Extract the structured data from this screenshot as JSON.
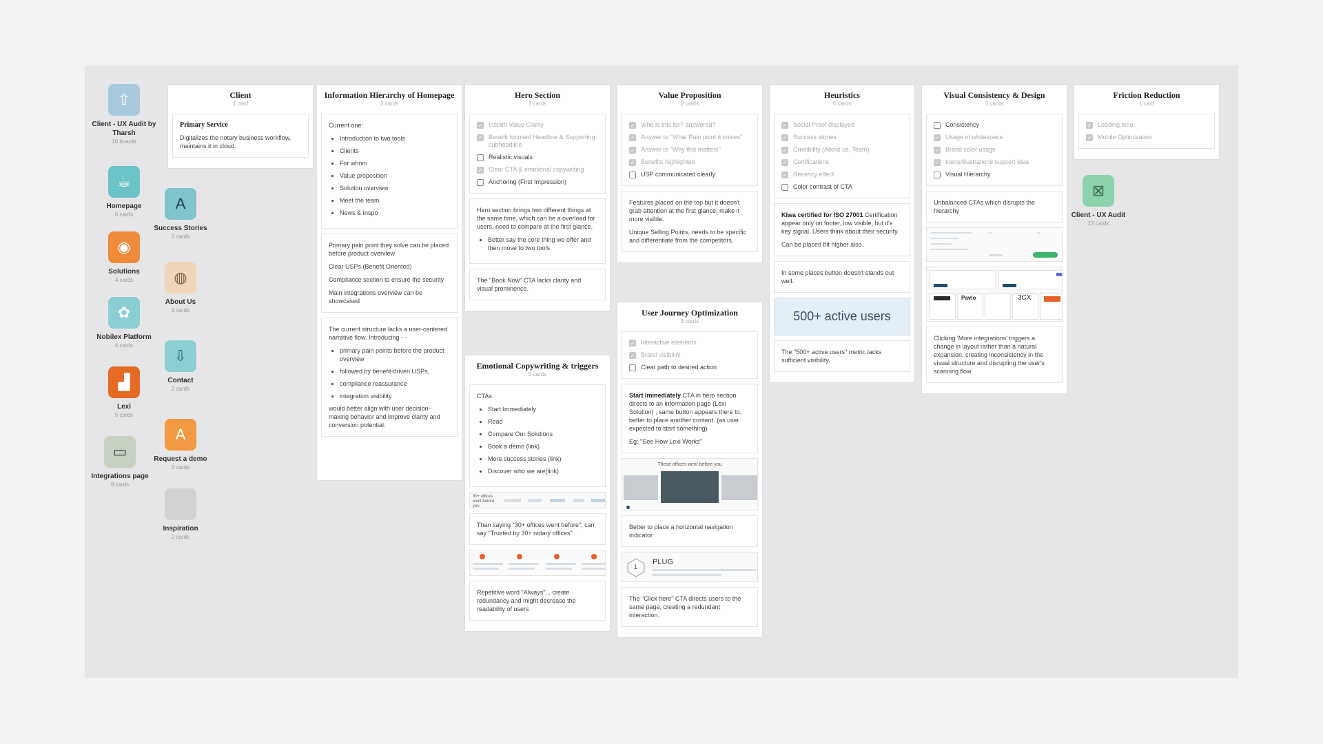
{
  "sidebar_boards": [
    {
      "name": "Client - UX Audit by Tharsh",
      "count": "10 boards",
      "icon": "upload-chart-icon",
      "color": "#a9c9dd"
    },
    {
      "name": "Homepage",
      "count": "6 cards",
      "icon": "coffee-icon",
      "color": "#6bc3c7"
    },
    {
      "name": "Solutions",
      "count": "4 cards",
      "icon": "basketball-icon",
      "color": "#ef8a3b"
    },
    {
      "name": "Nobilex Platform",
      "count": "4 cards",
      "icon": "butterfly-icon",
      "color": "#8ccfd3"
    },
    {
      "name": "Lexi",
      "count": "5 cards",
      "icon": "dog-icon",
      "color": "#e56a24"
    },
    {
      "name": "Integrations page",
      "count": "8 cards",
      "icon": "device-icon",
      "color": "#c5d2c2"
    },
    {
      "name": "Success Stories",
      "count": "3 cards",
      "icon": "book-icon",
      "color": "#7fc4cc"
    },
    {
      "name": "About Us",
      "count": "3 cards",
      "icon": "baseball-icon",
      "color": "#efd6b8"
    },
    {
      "name": "Contact",
      "count": "2 cards",
      "icon": "download-icon",
      "color": "#8ccfd3"
    },
    {
      "name": "Request a demo",
      "count": "3 cards",
      "icon": "letter-a-icon",
      "color": "#f19a43"
    },
    {
      "name": "Inspiration",
      "count": "2 cards",
      "icon": "blank-icon",
      "color": "#d2d2d4"
    },
    {
      "name": "Client - UX Audit",
      "count": "12 cards",
      "icon": "no-image-icon",
      "color": "#8cd3ad"
    }
  ],
  "tile_glyphs": {
    "upload": "⇧",
    "coffee": "☕",
    "ball": "◉",
    "butterfly": "✿",
    "dog": "▟",
    "device": "▭",
    "book": "A",
    "baseball": "◍",
    "download": "⇩",
    "letter": "A",
    "blank": "",
    "noimg": "⊠"
  },
  "columns": {
    "client": {
      "title": "Client",
      "count": "1 card",
      "card_title": "Primary Service",
      "card_text": "Digitalizes the notary business workflow, maintains it in cloud."
    },
    "info": {
      "title": "Information Hierarchy of Homepage",
      "count": "3 cards",
      "card1_intro": "Current one:",
      "card1_items": [
        "Introduction to two tools",
        "Clients",
        "For whom",
        "Value proposition",
        "Solution overview",
        "Meet the team",
        "News & Inspo"
      ],
      "card2_lines": [
        "Primary pain point they solve can be placed before product overview",
        "Clear USPs (Benefit Oriented)",
        "Compliance section to ensure the security",
        "Main integrations overview can be showcased"
      ],
      "card3_intro": "The current structure lacks a user-centered narrative flow. Introducing - -",
      "card3_items": [
        "primary pain points before the product overview",
        "followed by benefit-driven USPs,",
        "compliance reassurance",
        "integration visibility"
      ],
      "card3_outro": "would better align with user decision-making behavior and improve clarity and conversion potential."
    },
    "hero": {
      "title": "Hero Section",
      "count": "3 cards",
      "checklist": [
        {
          "label": "Instant Value Clarity",
          "done": true
        },
        {
          "label": "Benefit focused Headline & Supporting subheadline",
          "done": true
        },
        {
          "label": "Realistic visuals",
          "done": false
        },
        {
          "label": "Clear CTA & emotional copywriting",
          "done": true
        },
        {
          "label": "Anchoring (First Impression)",
          "done": false
        }
      ],
      "card2_text": "Hero section brings two different things at the same time, which can be a overload for users, need to compare at the first glance.",
      "card2_items": [
        "Better say the core thing we offer and then move to two tools"
      ],
      "card3_text": "The \"Book Now\" CTA lacks clarity and visual prominence."
    },
    "emotional": {
      "title": "Emotional Copywriting & triggers",
      "count": "5 cards",
      "card1_intro": "CTAs",
      "card1_items": [
        "Start Immediately",
        "Read",
        "Compare Our Solutions",
        "Book a demo (link)",
        "More success stories (link)",
        "Discover who we are(link)"
      ],
      "thumb1_text": "30+ offices went before you",
      "card2_text": "Than saying \"30+ offices went before\", can say \"Trusted by 30+ notary offices\"",
      "card3_text": "Repetitive word \"Always\"... create redundancy and might decrease the readability of users"
    },
    "value": {
      "title": "Value Proposition",
      "count": "2 cards",
      "checklist": [
        {
          "label": "Who is this for? answered?",
          "done": true
        },
        {
          "label": "Answer to \"What Pain point it solves\"",
          "done": true
        },
        {
          "label": "Answer to \"Why this matters\"",
          "done": true
        },
        {
          "label": "Benefits highlighted",
          "done": true
        },
        {
          "label": "USP communicated clearly",
          "done": false
        }
      ],
      "card2_p1": "Features placed on the top but it doesn't grab attention at the first glance, make it more visible.",
      "card2_p2": "Unique Selling Points, needs to be specific and differentiate from the competitors."
    },
    "journey": {
      "title": "User Journey Optimization",
      "count": "6 cards",
      "checklist": [
        {
          "label": "Interactive elements",
          "done": true
        },
        {
          "label": "Brand visibility",
          "done": true
        },
        {
          "label": "Clear path to desired action",
          "done": false
        }
      ],
      "card2_bold": "Start Immediately",
      "card2_text": " CTA in hero section directs to an information page (Lexi Solution) , same button appears there to, better to place another content. (as user expected to start something)",
      "card2_eg": "Eg: \"See How Lexi Works\"",
      "thumb1_caption": "These offices went before you",
      "card3_text": "Better to place a horizontal navigation indicator",
      "plug_title": "PLUG",
      "plug_number": "1",
      "card4_text": "The \"Click here\" CTA directs users to the same page, creating a redundant interaction."
    },
    "heuristics": {
      "title": "Heuristics",
      "count": "5 cards",
      "checklist": [
        {
          "label": "Social Proof displayed",
          "done": true
        },
        {
          "label": "Success stories",
          "done": true
        },
        {
          "label": "Credibility (About us, Team)",
          "done": true
        },
        {
          "label": "Certifications",
          "done": true
        },
        {
          "label": "Recency effect",
          "done": true
        },
        {
          "label": "Color contrast of CTA",
          "done": false
        }
      ],
      "card2_bold": "Kiwa certified for ISO 27001",
      "card2_text": " Certification appear only on footer, low visible, but it's key signal. Users think about their security.",
      "card2_p2": "Can be placed bit higher also.",
      "card3_text": "In some places button doesn't stands out well.",
      "metric": "500+ active users",
      "card5_text": "The \"500+ active users\" metric lacks sufficient visibility."
    },
    "visual": {
      "title": "Visual Consistency & Design",
      "count": "5 cards",
      "checklist": [
        {
          "label": "Consistency",
          "done": false
        },
        {
          "label": "Usage of whitespace",
          "done": true
        },
        {
          "label": "Brand color usage",
          "done": true
        },
        {
          "label": "Icons/illustrations support idea",
          "done": true
        },
        {
          "label": "Visual Hierarchy",
          "done": false
        }
      ],
      "card2_text": "Unbalanced CTAs which disrupts the hierarchy",
      "card3_text": "Clicking 'More integrations' triggers a change in layout rather than a natural expansion, creating inconsistency in the visual structure and disrupting the user's scanning flow",
      "logos": [
        "Pavlo",
        "3CX"
      ]
    },
    "friction": {
      "title": "Friction Reduction",
      "count": "1 card",
      "checklist": [
        {
          "label": "Loading time",
          "done": true
        },
        {
          "label": "Mobile Optimization",
          "done": true
        }
      ]
    }
  }
}
